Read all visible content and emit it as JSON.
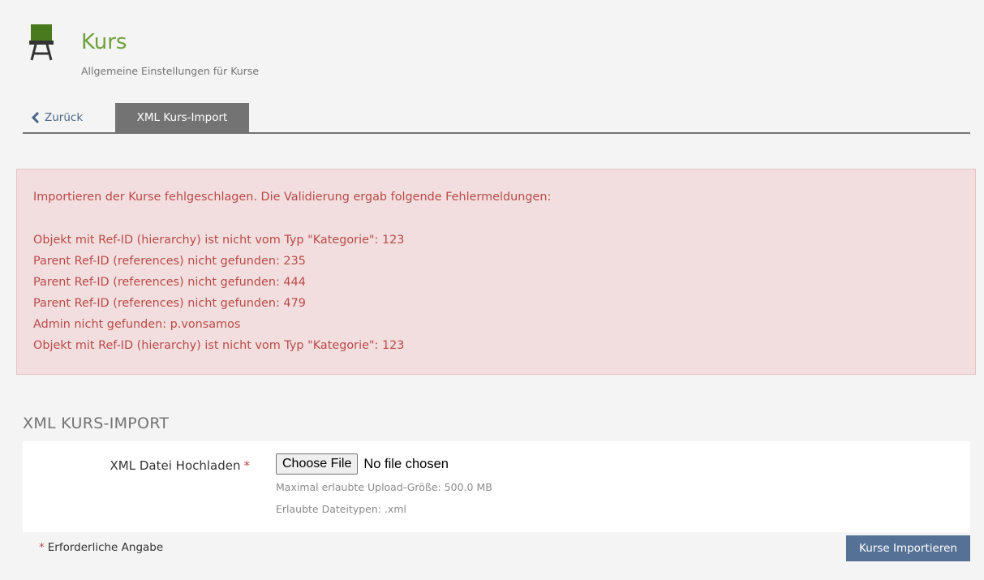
{
  "header": {
    "icon": "classroom-board-icon",
    "title": "Kurs",
    "subtitle": "Allgemeine Einstellungen für Kurse"
  },
  "tabs": {
    "back_label": "Zurück",
    "back_icon": "chevron-left-icon",
    "active_label": "XML Kurs-Import"
  },
  "alert": {
    "headline": "Importieren der Kurse fehlgeschlagen. Die Validierung ergab folgende Fehlermeldungen:",
    "errors": [
      "Objekt mit Ref-ID (hierarchy) ist nicht vom Typ \"Kategorie\": 123",
      "Parent Ref-ID (references) nicht gefunden: 235",
      "Parent Ref-ID (references) nicht gefunden: 444",
      "Parent Ref-ID (references) nicht gefunden: 479",
      "Admin nicht gefunden: p.vonsamos",
      "Objekt mit Ref-ID (hierarchy) ist nicht vom Typ \"Kategorie\": 123"
    ]
  },
  "form": {
    "section_title": "XML KURS-IMPORT",
    "upload_label": "XML Datei Hochladen",
    "required_marker": "*",
    "choose_file_label": "Choose File",
    "no_file_text": "No file chosen",
    "max_size_text": "Maximal erlaubte Upload-Größe: 500.0 MB",
    "allowed_types_text": "Erlaubte Dateitypen: .xml"
  },
  "footer": {
    "required_note": "Erforderliche Angabe",
    "submit_label": "Kurse Importieren"
  },
  "colors": {
    "brand_green": "#6ea03c",
    "alert_bg": "#f2dede",
    "alert_text": "#b94a48",
    "tab_active_bg": "#737373",
    "primary_button": "#557196",
    "link": "#4c6586"
  }
}
